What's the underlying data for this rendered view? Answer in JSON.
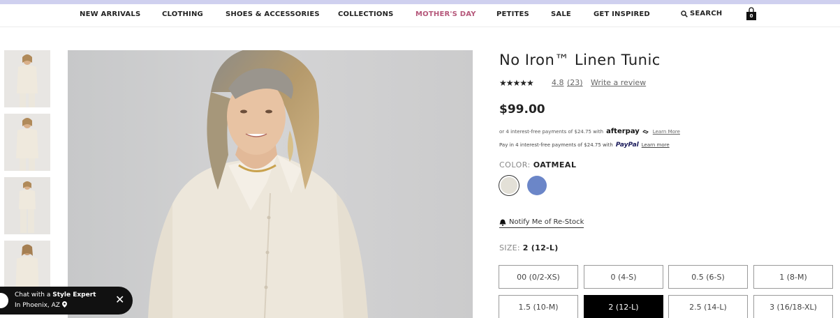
{
  "nav": {
    "items": [
      {
        "label": "NEW ARRIVALS"
      },
      {
        "label": "CLOTHING"
      },
      {
        "label": "SHOES & ACCESSORIES"
      },
      {
        "label": "COLLECTIONS"
      },
      {
        "label": "MOTHER'S DAY"
      },
      {
        "label": "PETITES"
      },
      {
        "label": "SALE"
      },
      {
        "label": "GET INSPIRED"
      }
    ],
    "search_label": "SEARCH",
    "bag_count": "0",
    "accent_color": "#b5577a"
  },
  "chat": {
    "prefix": "Chat with a ",
    "emphasis": "Style Expert",
    "location": "In Phoenix, AZ",
    "close_glyph": "✕"
  },
  "product": {
    "title": "No Iron™ Linen Tunic",
    "stars": "★★★★★",
    "rating": "4.8",
    "review_count": "(23)",
    "write_review": "Write a review",
    "price": "$99.00",
    "afterpay": {
      "text": "or 4 interest-free payments of $24.75 with",
      "brand": "afterpay",
      "link": "Learn More"
    },
    "paypal": {
      "text": "Pay in 4 interest-free payments of $24.75 with",
      "brand": "PayPal",
      "link": "Learn more"
    },
    "color": {
      "label": "COLOR:",
      "value": "OATMEAL",
      "swatches": [
        {
          "name": "oatmeal",
          "hex": "#e3e0d7",
          "selected": true
        },
        {
          "name": "blue",
          "hex": "#6b86c8",
          "selected": false
        }
      ]
    },
    "notify_label": "Notify Me of Re-Stock",
    "size": {
      "label": "SIZE:",
      "value": "2 (12-L)",
      "options": [
        {
          "label": "00 (0/2-XS)"
        },
        {
          "label": "0 (4-S)"
        },
        {
          "label": "0.5 (6-S)"
        },
        {
          "label": "1 (8-M)"
        },
        {
          "label": "1.5 (10-M)"
        },
        {
          "label": "2 (12-L)",
          "selected": true
        },
        {
          "label": "2.5 (14-L)"
        },
        {
          "label": "3 (16/18-XL)"
        }
      ]
    }
  },
  "icons": [
    "search-icon",
    "shopping-bag-icon",
    "bell-icon",
    "close-icon",
    "location-pin-icon"
  ]
}
